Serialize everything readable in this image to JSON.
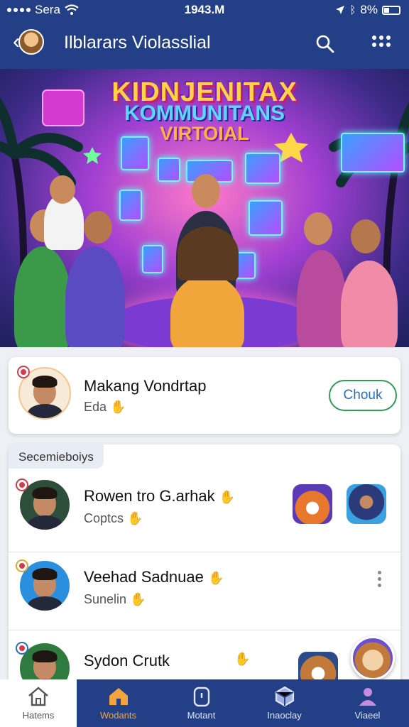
{
  "status": {
    "carrier": "Sera",
    "time": "1943.M",
    "battery": "8%"
  },
  "header": {
    "title": "Ilblarars Violasslial"
  },
  "hero": {
    "line1": "KIDNJENITAX",
    "line2": "KOMMUNITANS",
    "line3": "VIRTOIAL"
  },
  "featured": {
    "name": "Makang Vondrtap",
    "subtitle": "Eda",
    "button": "Chouk"
  },
  "list": {
    "label": "Secemieboiys",
    "rows": [
      {
        "name": "Rowen tro G.arhak",
        "subtitle": "Coptcs"
      },
      {
        "name": "Veehad Sadnuae",
        "subtitle": "Sunelin"
      },
      {
        "name": "Sydon Crutk",
        "subtitle": ""
      }
    ]
  },
  "nav": [
    {
      "label": "Hatems",
      "icon": "house-outline-icon"
    },
    {
      "label": "Wodants",
      "icon": "house-filled-icon"
    },
    {
      "label": "Motant",
      "icon": "timer-icon"
    },
    {
      "label": "Inaoclay",
      "icon": "cube-icon"
    },
    {
      "label": "Viaeel",
      "icon": "person-icon"
    }
  ],
  "colors": {
    "header": "#233f85",
    "accent": "#f3a43c",
    "button_border": "#2e9c5a"
  }
}
